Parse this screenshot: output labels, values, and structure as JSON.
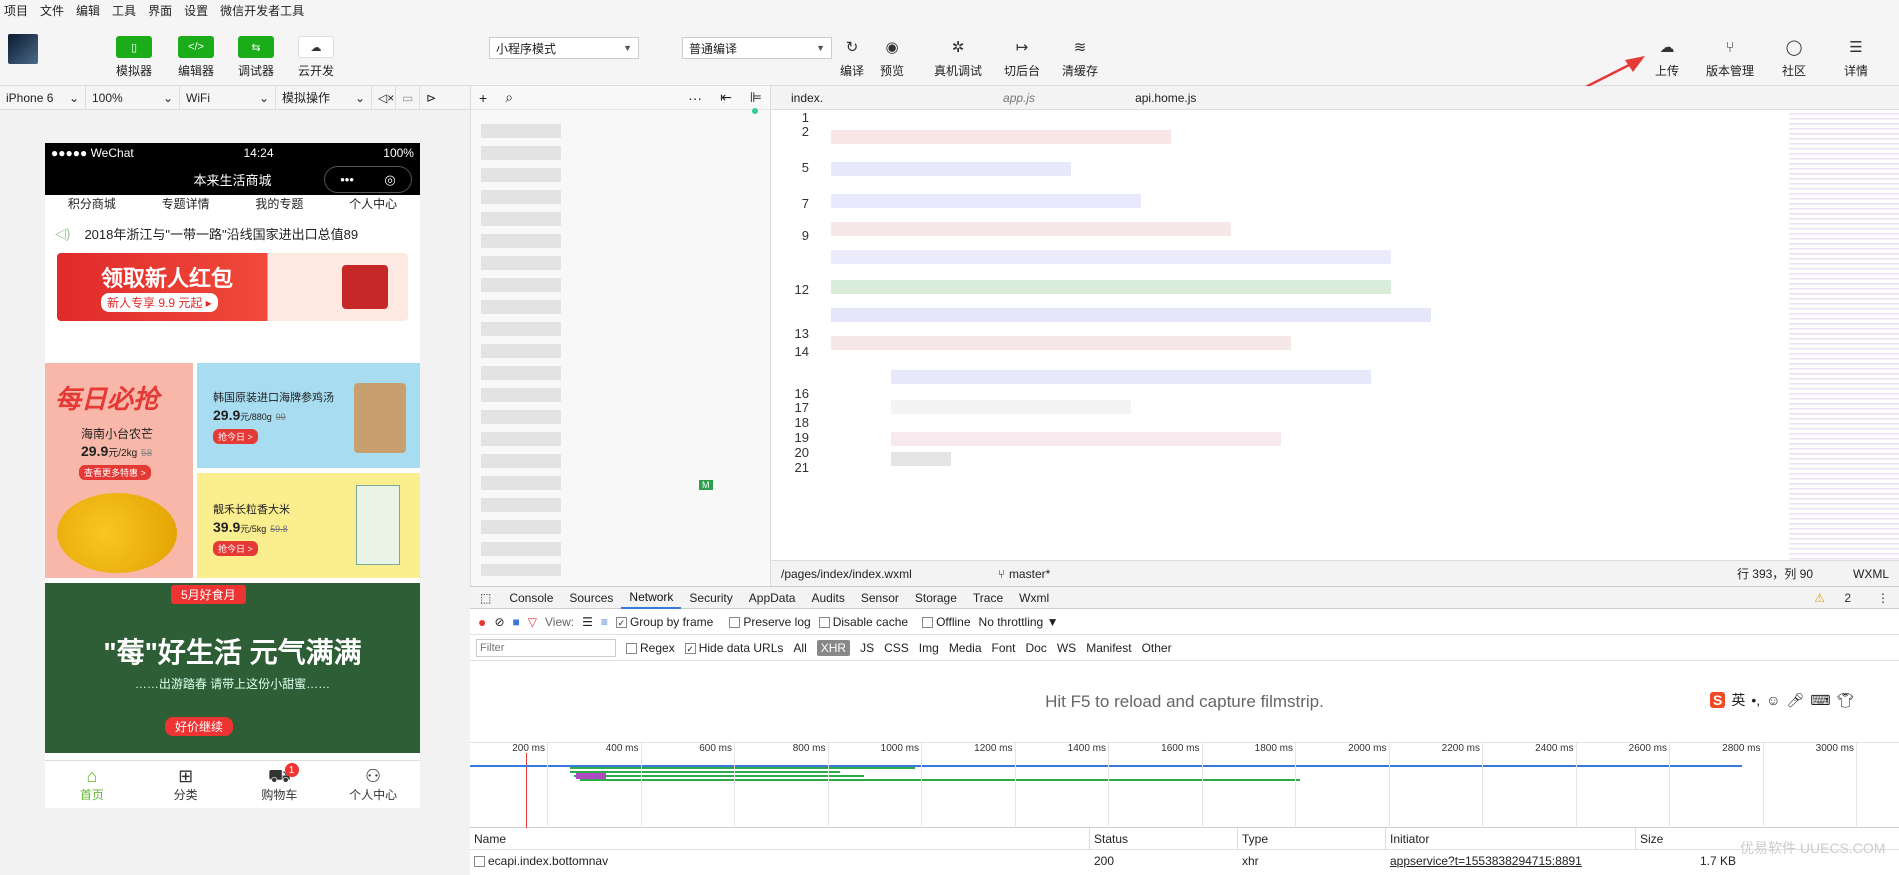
{
  "menubar": [
    "项目",
    "文件",
    "编辑",
    "工具",
    "界面",
    "设置",
    "微信开发者工具"
  ],
  "toolbar": {
    "simulator": "模拟器",
    "editor": "编辑器",
    "debugger": "调试器",
    "cloud": "云开发",
    "mode": "小程序模式",
    "compile_mode": "普通编译",
    "compile": "编译",
    "preview": "预览",
    "remote_debug": "真机调试",
    "background": "切后台",
    "clear_cache": "清缓存",
    "upload": "上传",
    "version": "版本管理",
    "community": "社区",
    "details": "详情"
  },
  "devbar": {
    "device": "iPhone 6",
    "zoom": "100%",
    "network": "WiFi",
    "operation": "模拟操作"
  },
  "phone": {
    "carrier": "●●●●● WeChat",
    "time": "14:24",
    "battery": "100%",
    "title": "本来生活商城",
    "top_tabs": [
      "积分商城",
      "专题详情",
      "我的专题",
      "个人中心"
    ],
    "notice": "2018年浙江与\"一带一路\"沿线国家进出口总值89",
    "banner_title": "领取新人红包",
    "banner_sub": "新人专享 9.9 元起 ▸",
    "daily": "每日必抢",
    "mango_name": "海南小台农芒",
    "mango_price": "29.9",
    "mango_unit": "元/2kg",
    "mango_old": "58",
    "mango_more": "查看更多特惠 >",
    "soup_name": "韩国原装进口海牌参鸡汤",
    "soup_price": "29.9",
    "soup_unit": "元/880g",
    "soup_old": "99",
    "rice_name": "靓禾长粒香大米",
    "rice_price": "39.9",
    "rice_unit": "元/5kg",
    "rice_old": "59.8",
    "grab": "抢今日 >",
    "promo_badge": "5月好食月",
    "promo_title": "\"莓\"好生活 元气满满",
    "promo_sub": "……出游踏春  请带上这份小甜蜜……",
    "promo_tag": "好价继续",
    "tabs": [
      "首页",
      "分类",
      "购物车",
      "个人中心"
    ],
    "cart_badge": "1"
  },
  "editor": {
    "tabs": [
      "index.",
      "app.js",
      "api.home.js"
    ],
    "line_numbers": [
      "1",
      "2",
      "5",
      "7",
      "9",
      "12",
      "13",
      "14",
      "16",
      "17",
      "18",
      "19",
      "20",
      "21"
    ],
    "path": "/pages/index/index.wxml",
    "branch": "master*",
    "cursor": "行 393，列 90",
    "lang": "WXML",
    "badge_m": "M"
  },
  "devtools": {
    "tabs": [
      "Console",
      "Sources",
      "Network",
      "Security",
      "AppData",
      "Audits",
      "Sensor",
      "Storage",
      "Trace",
      "Wxml"
    ],
    "warnings": "2",
    "view_label": "View:",
    "group_by_frame": "Group by frame",
    "preserve_log": "Preserve log",
    "disable_cache": "Disable cache",
    "offline": "Offline",
    "throttling": "No throttling",
    "filter_placeholder": "Filter",
    "regex": "Regex",
    "hide_data_urls": "Hide data URLs",
    "types": [
      "All",
      "XHR",
      "JS",
      "CSS",
      "Img",
      "Media",
      "Font",
      "Doc",
      "WS",
      "Manifest",
      "Other"
    ],
    "filmstrip_hint": "Hit F5 to reload and capture filmstrip.",
    "ticks": [
      "200 ms",
      "400 ms",
      "600 ms",
      "800 ms",
      "1000 ms",
      "1200 ms",
      "1400 ms",
      "1600 ms",
      "1800 ms",
      "2000 ms",
      "2200 ms",
      "2400 ms",
      "2600 ms",
      "2800 ms",
      "3000 ms"
    ],
    "columns": [
      "Name",
      "Status",
      "Type",
      "Initiator",
      "Size"
    ],
    "row": {
      "name": "ecapi.index.bottomnav",
      "status": "200",
      "type": "xhr",
      "initiator": "appservice?t=1553838294715:8891",
      "size": "1.7 KB"
    }
  },
  "watermark": "优易软件  UUECS.COM",
  "colors": {
    "accent_green": "#1aad19",
    "tab_active": "#67b52e",
    "arrow": "#e53935"
  }
}
